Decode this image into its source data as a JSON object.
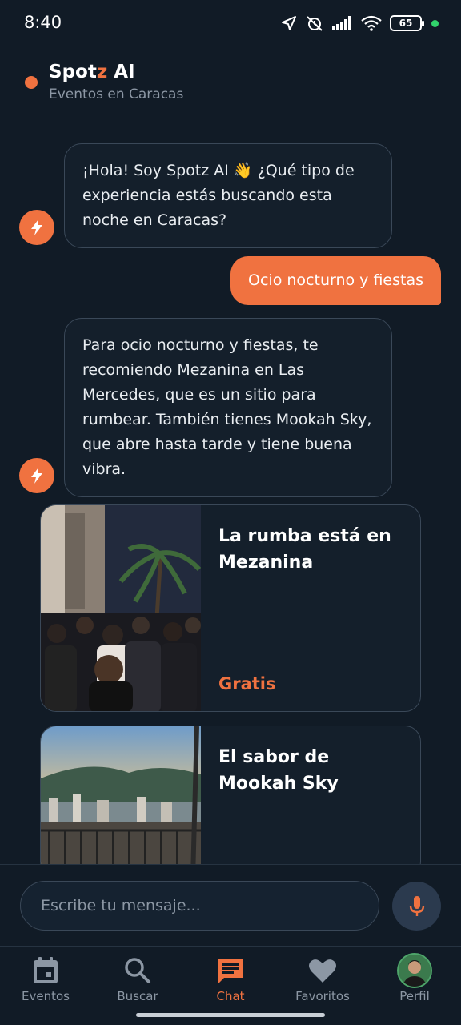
{
  "status_bar": {
    "time": "8:40",
    "battery": "65"
  },
  "header": {
    "title_main": "Spot",
    "title_accent": "z",
    "title_suffix": " AI",
    "subtitle": "Eventos en Caracas"
  },
  "chat": {
    "bot_message_1": "¡Hola! Soy Spotz AI 👋 ¿Qué tipo de experiencia estás buscando esta noche en Caracas?",
    "user_message_1": "Ocio nocturno y fiestas",
    "bot_message_2": "Para ocio nocturno y fiestas, te recomiendo Mezanina en Las Mercedes, que es un sitio para rumbear. También tienes Mookah Sky, que abre hasta tarde y tiene buena vibra."
  },
  "events": [
    {
      "title": "La rumba está en Mezanina",
      "price": "Gratis"
    },
    {
      "title": "El sabor de Mookah Sky",
      "price": ""
    }
  ],
  "input": {
    "placeholder": "Escribe tu mensaje..."
  },
  "nav": {
    "items": [
      {
        "label": "Eventos",
        "icon": "calendar-icon"
      },
      {
        "label": "Buscar",
        "icon": "search-icon"
      },
      {
        "label": "Chat",
        "icon": "chat-icon"
      },
      {
        "label": "Favoritos",
        "icon": "heart-icon"
      },
      {
        "label": "Perfil",
        "icon": "avatar"
      }
    ],
    "active": "Chat"
  },
  "colors": {
    "accent": "#f07240",
    "background": "#111b26",
    "muted": "#8c97a4"
  }
}
